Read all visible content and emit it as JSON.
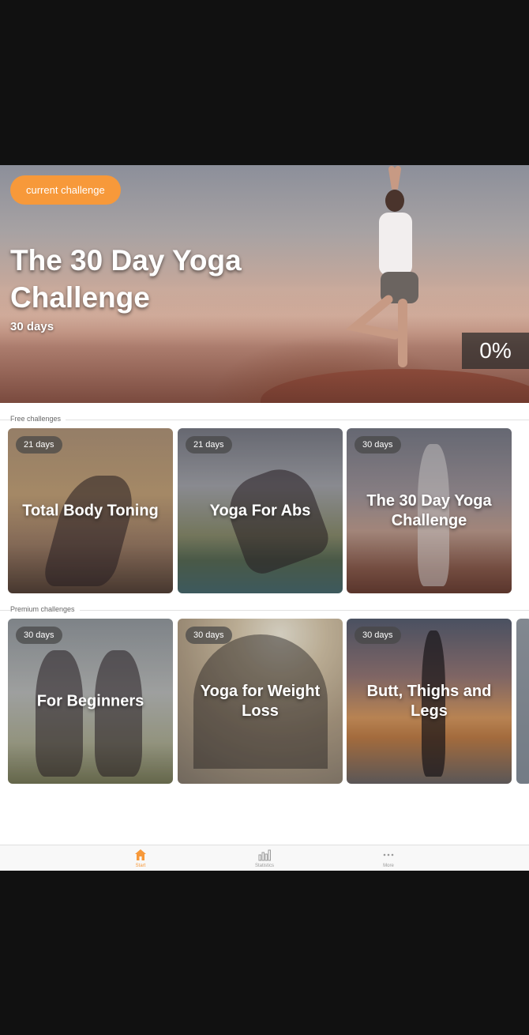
{
  "hero": {
    "badge_label": "current challenge",
    "title": "The 30 Day Yoga Challenge",
    "duration": "30 days",
    "progress": "0%"
  },
  "sections": {
    "free_label": "Free challenges",
    "premium_label": "Premium challenges"
  },
  "free_cards": [
    {
      "days": "21 days",
      "title": "Total Body Toning"
    },
    {
      "days": "21 days",
      "title": "Yoga For Abs"
    },
    {
      "days": "30 days",
      "title": "The 30 Day Yoga Challenge"
    }
  ],
  "premium_cards": [
    {
      "days": "30 days",
      "title": "For Beginners"
    },
    {
      "days": "30 days",
      "title": "Yoga for Weight Loss"
    },
    {
      "days": "30 days",
      "title": "Butt, Thighs and Legs"
    }
  ],
  "tabbar": {
    "items": [
      {
        "label": "Start",
        "icon": "home-icon",
        "active": true
      },
      {
        "label": "Statistics",
        "icon": "bar-chart-icon",
        "active": false
      },
      {
        "label": "More",
        "icon": "more-dots-icon",
        "active": false
      }
    ]
  },
  "colors": {
    "accent": "#f7993a",
    "background": "#ffffff",
    "letterbox": "#111111"
  }
}
